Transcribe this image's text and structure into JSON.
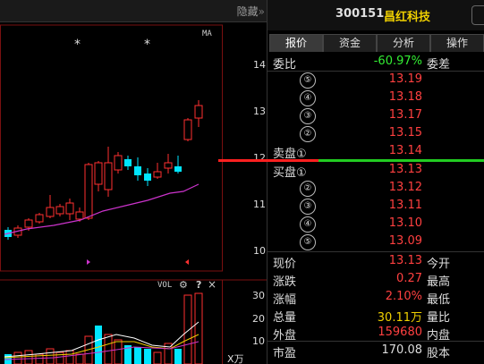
{
  "toolbar": {
    "hide_label": "隐藏"
  },
  "chart": {
    "ma_label": "MA",
    "vol_label": "VOL",
    "vol_unit": "X万",
    "price_axis": [
      "14",
      "13",
      "12",
      "11",
      "10"
    ],
    "vol_axis": [
      "30",
      "20",
      "10"
    ],
    "stars": [
      "*",
      "*"
    ],
    "colors": {
      "up": "#ff3030",
      "down": "#00e5ff",
      "ma": "#cc33cc",
      "grid": "#7a1010"
    }
  },
  "header": {
    "code": "300151",
    "name": "昌红科技"
  },
  "tabs": [
    "报价",
    "资金",
    "分析",
    "操作"
  ],
  "weibi": {
    "label": "委比",
    "value": "-60.97%",
    "label2": "委差"
  },
  "sell_levels": [
    {
      "label": "",
      "level": "⑤",
      "price": "13.19"
    },
    {
      "label": "",
      "level": "④",
      "price": "13.18"
    },
    {
      "label": "",
      "level": "③",
      "price": "13.17"
    },
    {
      "label": "",
      "level": "②",
      "price": "13.15"
    },
    {
      "label": "卖盘①",
      "level": "",
      "price": "13.14"
    }
  ],
  "buy_levels": [
    {
      "label": "买盘①",
      "level": "",
      "price": "13.13"
    },
    {
      "label": "",
      "level": "②",
      "price": "13.12"
    },
    {
      "label": "",
      "level": "③",
      "price": "13.11"
    },
    {
      "label": "",
      "level": "④",
      "price": "13.10"
    },
    {
      "label": "",
      "level": "⑤",
      "price": "13.09"
    }
  ],
  "stats": [
    {
      "label": "现价",
      "value": "13.13",
      "label2": "今开"
    },
    {
      "label": "涨跌",
      "value": "0.27",
      "label2": "最高"
    },
    {
      "label": "涨幅",
      "value": "2.10%",
      "label2": "最低"
    },
    {
      "label": "总量",
      "value": "30.11万",
      "label2": "量比"
    },
    {
      "label": "外盘",
      "value": "159680",
      "label2": "内盘"
    },
    {
      "label": "市盈",
      "value": "170.08",
      "label2": "股本"
    }
  ]
}
